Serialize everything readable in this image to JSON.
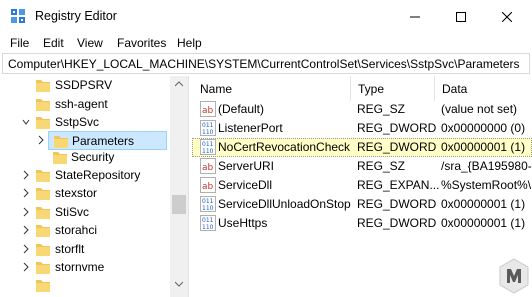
{
  "window": {
    "title": "Registry Editor"
  },
  "menu": [
    "File",
    "Edit",
    "View",
    "Favorites",
    "Help"
  ],
  "address": "Computer\\HKEY_LOCAL_MACHINE\\SYSTEM\\CurrentControlSet\\Services\\SstpSvc\\Parameters",
  "tree": {
    "items": [
      {
        "label": "SSDPSRV"
      },
      {
        "label": "ssh-agent"
      },
      {
        "label": "SstpSvc"
      },
      {
        "label": "Parameters"
      },
      {
        "label": "Security"
      },
      {
        "label": "StateRepository"
      },
      {
        "label": "stexstor"
      },
      {
        "label": "StiSvc"
      },
      {
        "label": "storahci"
      },
      {
        "label": "storflt"
      },
      {
        "label": "stornvme"
      }
    ]
  },
  "columns": {
    "name": "Name",
    "type": "Type",
    "data": "Data"
  },
  "values": [
    {
      "name": "(Default)",
      "type": "REG_SZ",
      "data": "(value not set)",
      "icon": "string-value-icon"
    },
    {
      "name": "ListenerPort",
      "type": "REG_DWORD",
      "data": "0x00000000 (0)",
      "icon": "binary-value-icon"
    },
    {
      "name": "NoCertRevocationCheck",
      "type": "REG_DWORD",
      "data": "0x00000001 (1)",
      "icon": "binary-value-icon"
    },
    {
      "name": "ServerURI",
      "type": "REG_SZ",
      "data": "/sra_{BA195980-",
      "icon": "string-value-icon"
    },
    {
      "name": "ServiceDll",
      "type": "REG_EXPAN...",
      "data": "%SystemRoot%\\",
      "icon": "string-value-icon"
    },
    {
      "name": "ServiceDllUnloadOnStop",
      "type": "REG_DWORD",
      "data": "0x00000001 (1)",
      "icon": "binary-value-icon"
    },
    {
      "name": "UseHttps",
      "type": "REG_DWORD",
      "data": "0x00000001 (1)",
      "icon": "binary-value-icon"
    }
  ],
  "colors": {
    "selection_tree": "#cce8ff",
    "selection_list": "#ffffc6",
    "folder": "#f2c55c"
  }
}
